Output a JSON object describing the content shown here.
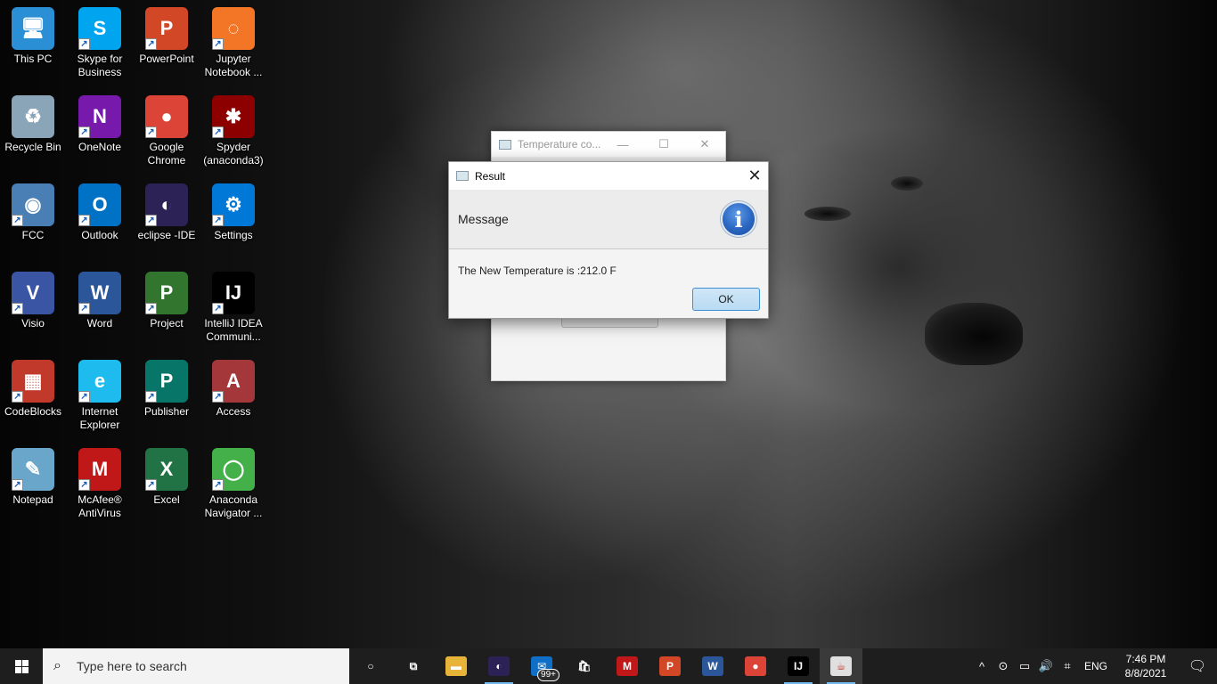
{
  "desktop": {
    "icons": [
      {
        "label": "This PC",
        "glyph": "🖥",
        "color": "#2b8fd6"
      },
      {
        "label": "Skype for Business",
        "glyph": "S",
        "color": "#00a4ef"
      },
      {
        "label": "PowerPoint",
        "glyph": "P",
        "color": "#d24726"
      },
      {
        "label": "Jupyter Notebook ...",
        "glyph": "◌",
        "color": "#f37626"
      },
      {
        "label": "Recycle Bin",
        "glyph": "♻",
        "color": "#8aa4b8"
      },
      {
        "label": "OneNote",
        "glyph": "N",
        "color": "#7719aa"
      },
      {
        "label": "Google Chrome",
        "glyph": "●",
        "color": "#db4437"
      },
      {
        "label": "Spyder (anaconda3)",
        "glyph": "✱",
        "color": "#8c0000"
      },
      {
        "label": "FCC",
        "glyph": "◉",
        "color": "#4a7fb5"
      },
      {
        "label": "Outlook",
        "glyph": "O",
        "color": "#0072c6"
      },
      {
        "label": "eclipse -IDE",
        "glyph": "◐",
        "color": "#2c2255"
      },
      {
        "label": "Settings",
        "glyph": "⚙",
        "color": "#0078d7"
      },
      {
        "label": "Visio",
        "glyph": "V",
        "color": "#3955a3"
      },
      {
        "label": "Word",
        "glyph": "W",
        "color": "#2b579a"
      },
      {
        "label": "Project",
        "glyph": "P",
        "color": "#31752f"
      },
      {
        "label": "IntelliJ IDEA Communi...",
        "glyph": "IJ",
        "color": "#000000"
      },
      {
        "label": "CodeBlocks",
        "glyph": "▦",
        "color": "#c0392b"
      },
      {
        "label": "Internet Explorer",
        "glyph": "e",
        "color": "#1ebbee"
      },
      {
        "label": "Publisher",
        "glyph": "P",
        "color": "#077568"
      },
      {
        "label": "Access",
        "glyph": "A",
        "color": "#a4373a"
      },
      {
        "label": "Notepad",
        "glyph": "✎",
        "color": "#6aa6c9"
      },
      {
        "label": "McAfee® AntiVirus",
        "glyph": "M",
        "color": "#c01818"
      },
      {
        "label": "Excel",
        "glyph": "X",
        "color": "#217346"
      },
      {
        "label": "Anaconda Navigator ...",
        "glyph": "◯",
        "color": "#43b049"
      }
    ]
  },
  "background_window": {
    "title": "Temperature co...",
    "minimize": "—",
    "maximize": "☐",
    "close": "✕"
  },
  "dialog": {
    "title": "Result",
    "close": "✕",
    "header_text": "Message",
    "info_glyph": "i",
    "content": "The New Temperature is :212.0 F",
    "ok_label": "OK"
  },
  "taskbar": {
    "search_placeholder": "Type here to search",
    "search_glyph": "⌕",
    "apps": [
      {
        "name": "cortana",
        "glyph": "○",
        "color": "transparent"
      },
      {
        "name": "task-view",
        "glyph": "⧉",
        "color": "transparent"
      },
      {
        "name": "file-explorer",
        "glyph": "▬",
        "color": "#e8b339"
      },
      {
        "name": "eclipse",
        "glyph": "◐",
        "color": "#2c2255"
      },
      {
        "name": "mail",
        "glyph": "✉",
        "color": "#0f6fc6",
        "badge": "99+"
      },
      {
        "name": "store",
        "glyph": "🛍",
        "color": "transparent"
      },
      {
        "name": "mcafee",
        "glyph": "M",
        "color": "#c01818"
      },
      {
        "name": "powerpoint",
        "glyph": "P",
        "color": "#d24726"
      },
      {
        "name": "word",
        "glyph": "W",
        "color": "#2b579a"
      },
      {
        "name": "chrome",
        "glyph": "●",
        "color": "#db4437"
      },
      {
        "name": "intellij",
        "glyph": "IJ",
        "color": "#000000"
      },
      {
        "name": "java",
        "glyph": "☕",
        "color": "#e0e0e0"
      }
    ],
    "tray": {
      "chevron": "^",
      "icons": [
        "⊙",
        "▭",
        "🔊",
        "⌗"
      ],
      "language": "ENG",
      "time": "7:46 PM",
      "date": "8/8/2021",
      "notification_glyph": "🗨"
    }
  }
}
